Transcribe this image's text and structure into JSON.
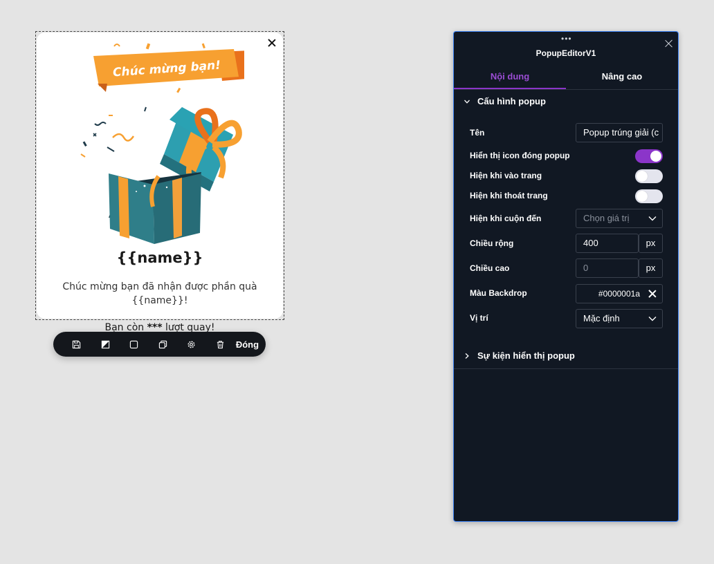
{
  "popup": {
    "banner_text": "Chúc mừng bạn!",
    "title": "{{name}}",
    "body": "Chúc mừng bạn đã nhận được phần quà {{name}}!",
    "spins_prefix": "Bạn còn ",
    "spins_count": "***",
    "spins_suffix": " lượt quay!"
  },
  "toolbar": {
    "close_label": "Đóng",
    "icons": [
      "save-icon",
      "contrast-icon",
      "square-icon",
      "duplicate-icon",
      "gear-icon",
      "trash-icon"
    ]
  },
  "panel": {
    "title": "PopupEditorV1",
    "drag_handle": "•••",
    "tabs": [
      {
        "label": "Nội dung",
        "active": true
      },
      {
        "label": "Nâng cao",
        "active": false
      }
    ],
    "section_config": "Cấu hình popup",
    "section_events": "Sự kiện hiển thị popup",
    "fields": {
      "name_label": "Tên",
      "name_value": "Popup trúng giải (c",
      "show_close_icon_label": "Hiển thị icon đóng popup",
      "show_close_icon": true,
      "show_on_enter_label": "Hiện khi vào trang",
      "show_on_enter": false,
      "show_on_exit_label": "Hiện khi thoát trang",
      "show_on_exit": false,
      "show_on_scroll_label": "Hiện khi cuộn đến",
      "show_on_scroll_placeholder": "Chọn giá trị",
      "width_label": "Chiều rộng",
      "width_value": "400",
      "width_unit": "px",
      "height_label": "Chiều cao",
      "height_placeholder": "0",
      "height_unit": "px",
      "backdrop_label": "Màu Backdrop",
      "backdrop_value": "#0000001a",
      "position_label": "Vị trí",
      "position_value": "Mặc định"
    }
  },
  "colors": {
    "accent": "#8b35c9",
    "panel_bg": "#111823",
    "panel_border": "#3b82f6",
    "canvas_bg": "#e4e4e4",
    "toolbar_bg": "#14171c"
  }
}
